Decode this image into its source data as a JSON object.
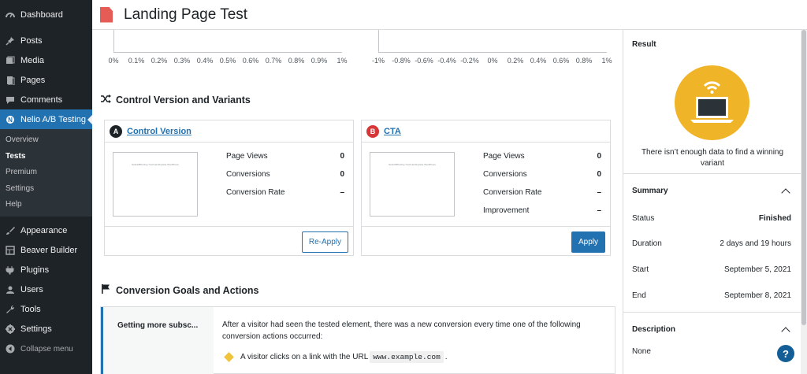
{
  "sidebar": {
    "items_top": [
      {
        "label": "Dashboard",
        "icon": "dashboard-icon"
      },
      {
        "label": "Posts",
        "icon": "pin-icon"
      },
      {
        "label": "Media",
        "icon": "media-icon"
      },
      {
        "label": "Pages",
        "icon": "pages-icon"
      },
      {
        "label": "Comments",
        "icon": "comments-icon"
      },
      {
        "label": "Nelio A/B Testing",
        "icon": "nelio-icon"
      }
    ],
    "submenu": [
      "Overview",
      "Tests",
      "Premium",
      "Settings",
      "Help"
    ],
    "items_bottom": [
      {
        "label": "Appearance",
        "icon": "brush-icon"
      },
      {
        "label": "Beaver Builder",
        "icon": "grid-icon"
      },
      {
        "label": "Plugins",
        "icon": "plug-icon"
      },
      {
        "label": "Users",
        "icon": "users-icon"
      },
      {
        "label": "Tools",
        "icon": "wrench-icon"
      },
      {
        "label": "Settings",
        "icon": "settings-icon"
      }
    ],
    "collapse": "Collapse menu"
  },
  "header": {
    "title": "Landing Page Test"
  },
  "charts": {
    "left_ticks": [
      "0%",
      "0.1%",
      "0.2%",
      "0.3%",
      "0.4%",
      "0.5%",
      "0.6%",
      "0.7%",
      "0.8%",
      "0.9%",
      "1%"
    ],
    "right_ticks": [
      "-1%",
      "-0.8%",
      "-0.6%",
      "-0.4%",
      "-0.2%",
      "0%",
      "0.2%",
      "0.4%",
      "0.6%",
      "0.8%",
      "1%"
    ]
  },
  "variants": {
    "section_title": "Control Version and Variants",
    "control": {
      "badge": "A",
      "name": "Control Version",
      "preview_text": "NelioABTesting  Your/Landing/site WordPress",
      "stats": [
        {
          "label": "Page Views",
          "value": "0"
        },
        {
          "label": "Conversions",
          "value": "0"
        },
        {
          "label": "Conversion Rate",
          "value": "–"
        }
      ],
      "button": "Re-Apply"
    },
    "variant": {
      "badge": "B",
      "name": "CTA",
      "preview_text": "NelioABTesting  Your/Landing/site WordPress",
      "stats": [
        {
          "label": "Page Views",
          "value": "0"
        },
        {
          "label": "Conversions",
          "value": "0"
        },
        {
          "label": "Conversion Rate",
          "value": "–"
        },
        {
          "label": "Improvement",
          "value": "–"
        }
      ],
      "button": "Apply"
    }
  },
  "goals": {
    "section_title": "Conversion Goals and Actions",
    "goal_name": "Getting more subsc...",
    "description": "After a visitor had seen the tested element, there was a new conversion every time one of the following conversion actions occurred:",
    "action_prefix": "A visitor clicks on a link with the URL",
    "action_url": "www.example.com",
    "action_suffix": "."
  },
  "result": {
    "title": "Result",
    "message": "There isn’t enough data to find a winning variant"
  },
  "summary": {
    "title": "Summary",
    "rows": [
      {
        "label": "Status",
        "value": "Finished"
      },
      {
        "label": "Duration",
        "value": "2 days and 19 hours"
      },
      {
        "label": "Start",
        "value": "September 5, 2021"
      },
      {
        "label": "End",
        "value": "September 8, 2021"
      }
    ]
  },
  "description": {
    "title": "Description",
    "value": "None"
  },
  "help": "?",
  "colors": {
    "accent": "#2271b1",
    "sidebar": "#1d2327",
    "result": "#f0b429",
    "badge_a": "#1d2327",
    "badge_b": "#d63638",
    "doc_icon": "#e45c55"
  }
}
